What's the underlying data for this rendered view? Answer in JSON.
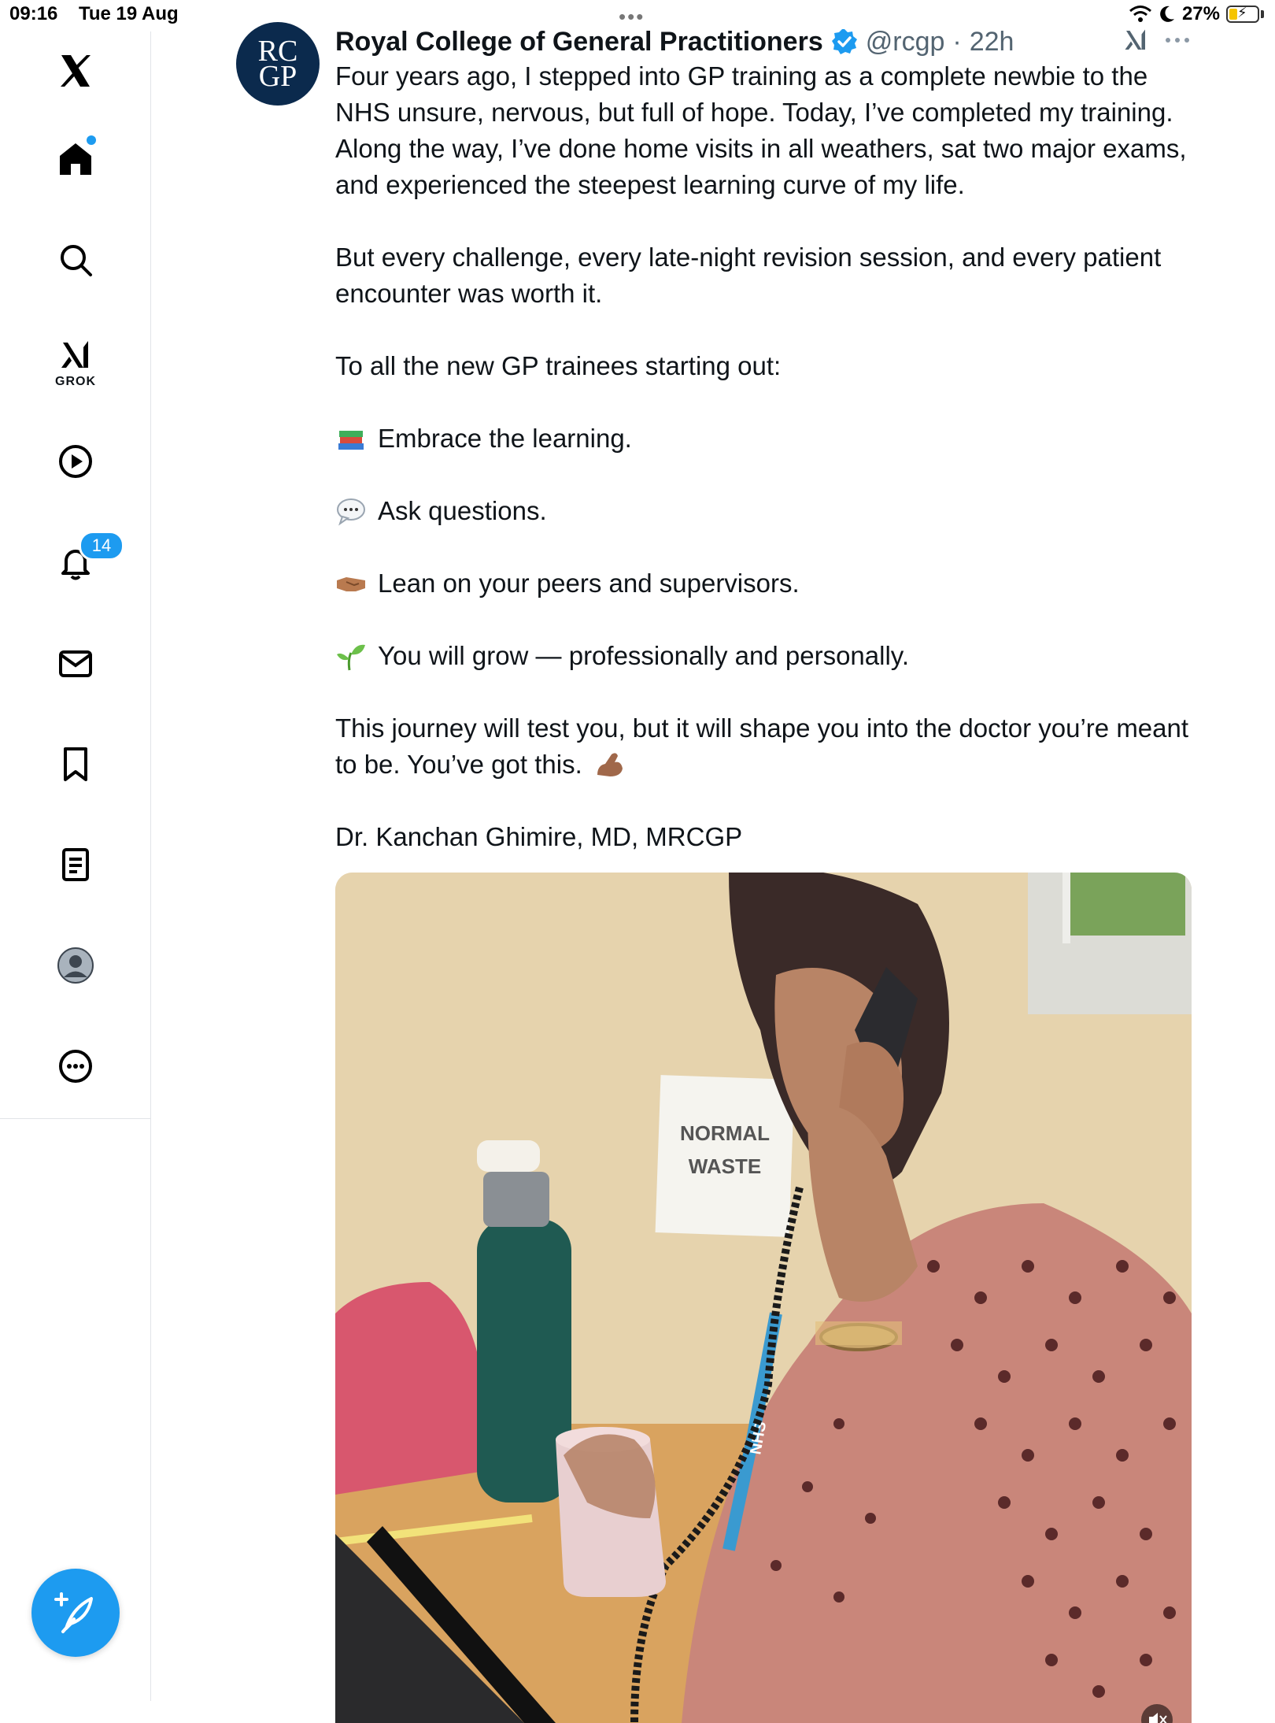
{
  "status_bar": {
    "time": "09:16",
    "date": "Tue 19 Aug",
    "battery": "27%",
    "icons": [
      "wifi-icon",
      "moon-icon",
      "battery-charging-icon"
    ]
  },
  "sidebar": {
    "items": [
      {
        "name": "x-logo-icon"
      },
      {
        "name": "home-icon",
        "dot": true
      },
      {
        "name": "search-icon"
      },
      {
        "name": "grok-icon",
        "label": "GROK"
      },
      {
        "name": "video-play-icon"
      },
      {
        "name": "notifications-bell-icon",
        "badge": "14"
      },
      {
        "name": "messages-envelope-icon"
      },
      {
        "name": "bookmark-icon"
      },
      {
        "name": "lists-icon"
      },
      {
        "name": "profile-avatar-icon"
      },
      {
        "name": "more-circle-icon"
      }
    ],
    "compose_icon": "compose-post-icon",
    "accent": "#1d9bf0"
  },
  "tweet": {
    "avatar_text_top": "RC",
    "avatar_text_bottom": "GP",
    "author": "Royal College of General Practitioners",
    "verified": true,
    "handle": "@rcgp",
    "separator": "·",
    "time": "22h",
    "paragraphs": {
      "p1": "Four years ago, I stepped into GP training as a complete newbie to the NHS unsure, nervous, but full of hope. Today, I’ve completed my training. Along the way, I’ve done home visits in all weathers, sat two major exams, and experienced the steepest learning curve of my life.",
      "p2": "But every challenge, every late-night revision session, and every patient encounter was worth it.",
      "p3": "To all the new GP trainees starting out:",
      "b1": "Embrace the learning.",
      "b2": "Ask questions.",
      "b3": "Lean on your peers and supervisors.",
      "b4": "You will grow — professionally and personally.",
      "p4": "This journey will test you, but it will shape you into the doctor you’re meant to be. You’ve got this.",
      "sig": "Dr. Kanchan Ghimire, MD, MRCGP"
    },
    "emoji_icons": [
      "books-emoji-icon",
      "speech-bubble-emoji-icon",
      "handshake-emoji-icon",
      "seedling-emoji-icon",
      "flexed-biceps-emoji-icon"
    ],
    "media": {
      "sign_line1": "NORMAL",
      "sign_line2": "WASTE",
      "badge_text": "NHS"
    }
  }
}
